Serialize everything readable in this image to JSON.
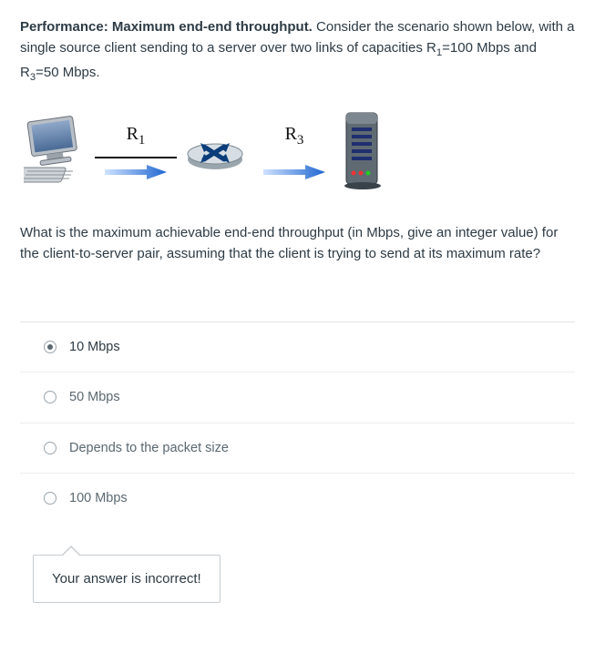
{
  "question": {
    "title": "Performance: Maximum end-end throughput.",
    "description_1": "Consider the scenario shown below, with a single source client sending to a server over two links of capacities R",
    "r1_sub": "1",
    "r1_text": "=100 Mbps and R",
    "r3_sub": "3",
    "r3_text": "=50 Mbps.",
    "followup": "What is the maximum achievable end-end throughput (in Mbps, give an integer value) for the client-to-server pair, assuming that the client is trying to send at its maximum rate?"
  },
  "diagram": {
    "label_r1": "R",
    "label_r1_sub": "1",
    "label_r3": "R",
    "label_r3_sub": "3"
  },
  "answers": [
    {
      "label": "10 Mbps",
      "selected": true
    },
    {
      "label": "50 Mbps",
      "selected": false
    },
    {
      "label": "Depends to the packet size",
      "selected": false
    },
    {
      "label": "100 Mbps",
      "selected": false
    }
  ],
  "feedback": {
    "text": "Your answer is incorrect!"
  }
}
